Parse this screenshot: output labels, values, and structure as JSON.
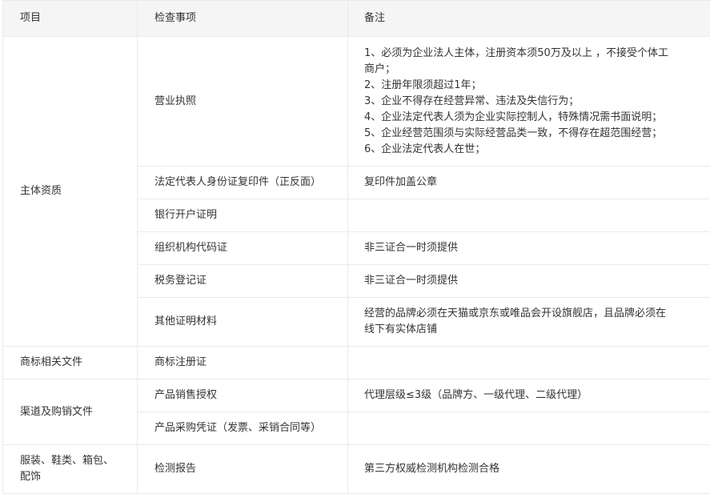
{
  "headers": [
    "项目",
    "检查事项",
    "备注"
  ],
  "rows": [
    {
      "category": "主体资质",
      "item": "营业执照",
      "notes": [
        "1、必须为企业法人主体，注册资本须50万及以上 ，不接受个体工",
        "商户；",
        "2、注册年限须超过1年；",
        "3、企业不得存在经营异常、违法及失信行为；",
        "4、企业法定代表人须为企业实际控制人，特殊情况需书面说明；",
        "5、企业经营范围须与实际经营品类一致，不得存在超范围经营；",
        "6、企业法定代表人在世；"
      ]
    },
    {
      "item": "法定代表人身份证复印件（正反面）",
      "notes": [
        "复印件加盖公章"
      ]
    },
    {
      "item": "银行开户证明",
      "notes": []
    },
    {
      "item": "组织机构代码证",
      "notes": [
        "非三证合一时须提供"
      ]
    },
    {
      "item": "税务登记证",
      "notes": [
        "非三证合一时须提供"
      ]
    },
    {
      "item": "其他证明材料",
      "notes": [
        "经营的品牌必须在天猫或京东或唯品会开设旗舰店，且品牌必须在",
        "线下有实体店铺"
      ]
    },
    {
      "category": "商标相关文件",
      "item": "商标注册证",
      "notes": []
    },
    {
      "category": "渠道及购销文件",
      "item": "产品销售授权",
      "notes": [
        "代理层级≤3级（品牌方、一级代理、二级代理）"
      ]
    },
    {
      "item": "产品采购凭证（发票、采销合同等）",
      "notes": []
    },
    {
      "category": "服装、鞋类、箱包、配饰",
      "category_lines": [
        "服装、鞋类、箱包、",
        "配饰"
      ],
      "item": "检测报告",
      "notes": [
        "第三方权威检测机构检测合格"
      ]
    }
  ]
}
